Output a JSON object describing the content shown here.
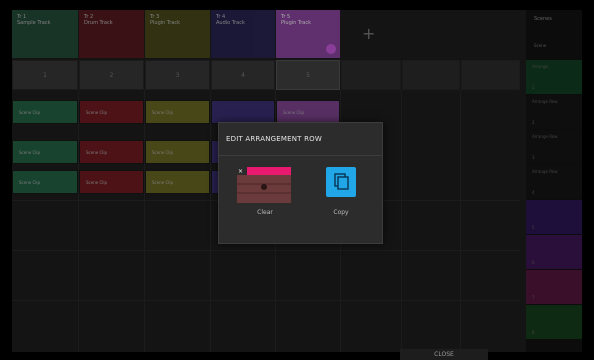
{
  "tracks": [
    {
      "name": "Tr 1",
      "sub": "Sample Track",
      "color": "#1b4f36"
    },
    {
      "name": "Tr 2",
      "sub": "Drum Track",
      "color": "#5a0f15"
    },
    {
      "name": "Tr 3",
      "sub": "Plugin Track",
      "color": "#4b4a10"
    },
    {
      "name": "Tr 4",
      "sub": "Audio Track",
      "color": "#221b55"
    },
    {
      "name": "Tr 5",
      "sub": "Plugin Track",
      "color": "#7a3a8c"
    }
  ],
  "add_track": "+",
  "numbers": [
    "1",
    "2",
    "3",
    "4",
    "5"
  ],
  "clips": [
    {
      "row": 0,
      "label": "Scene Clip",
      "color": "#1a6b46"
    },
    {
      "row": 0,
      "label": "Scene Clip",
      "color": "#7d1219"
    },
    {
      "row": 0,
      "label": "Scene Clip",
      "color": "#73711a"
    },
    {
      "row": 0,
      "label": "",
      "color": "#3a2a80"
    },
    {
      "row": 0,
      "label": "Scene Clip",
      "color": "#8e46a4"
    },
    {
      "row": 1,
      "label": "Scene Clip",
      "color": "#1a6b46"
    },
    {
      "row": 1,
      "label": "Scene Clip",
      "color": "#7d1219"
    },
    {
      "row": 1,
      "label": "Scene Clip",
      "color": "#73711a"
    },
    {
      "row": 1,
      "label": "",
      "color": "#3a2a80"
    },
    {
      "row": 2,
      "label": "Scene Clip",
      "color": "#1a6b46"
    },
    {
      "row": 2,
      "label": "Scene Clip",
      "color": "#7d1219"
    },
    {
      "row": 2,
      "label": "Scene Clip",
      "color": "#73711a"
    },
    {
      "row": 2,
      "label": "",
      "color": "#3a2a80"
    }
  ],
  "right_panel": {
    "header": "Scenes",
    "subheader": "Scene",
    "items": [
      {
        "label": "Arrange",
        "sub": "1",
        "color": "#0c2a18"
      },
      {
        "label": "Arrange Row",
        "sub": "2",
        "color": "#0e0e0e"
      },
      {
        "label": "Arrange Row",
        "sub": "3",
        "color": "#0e0e0e"
      },
      {
        "label": "Arrange Row",
        "sub": "4",
        "color": "#0e0e0e"
      },
      {
        "label": "",
        "sub": "5",
        "color": "#1e0f3a"
      },
      {
        "label": "",
        "sub": "6",
        "color": "#2a0f3a"
      },
      {
        "label": "",
        "sub": "7",
        "color": "#3a0f2a"
      },
      {
        "label": "",
        "sub": "8",
        "color": "#0f2a12"
      }
    ]
  },
  "dialog": {
    "title": "EDIT ARRANGEMENT ROW",
    "options": [
      {
        "label": "Clear",
        "icon": "clear-icon",
        "accent": "#e8196e"
      },
      {
        "label": "Copy",
        "icon": "copy-icon",
        "accent": "#21a6e8"
      }
    ]
  },
  "footer": {
    "close_label": "CLOSE"
  }
}
